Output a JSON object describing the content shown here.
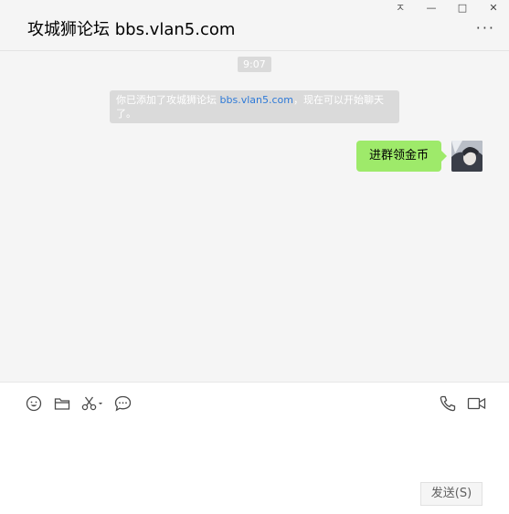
{
  "window": {
    "pin_glyph": "ㅈ",
    "minimize_glyph": "—",
    "maximize_glyph": "□",
    "close_glyph": "✕"
  },
  "header": {
    "title": "攻城狮论坛 bbs.vlan5.com",
    "more_glyph": "···"
  },
  "chat": {
    "timestamp": "9:07",
    "system_message": {
      "prefix": "你已添加了攻城狮论坛 ",
      "link": "bbs.vlan5.com",
      "suffix": "，现在可以开始聊天了。"
    },
    "messages": [
      {
        "text": "进群领金币",
        "sender": "me"
      }
    ]
  },
  "toolbar": {
    "icons": [
      "emoji-icon",
      "folder-icon",
      "scissors-icon",
      "chat-bubble-icon",
      "phone-icon",
      "video-icon"
    ]
  },
  "composer": {
    "send_label": "发送(S)"
  },
  "colors": {
    "bubble": "#9eea6a",
    "link": "#2e7ad8",
    "background": "#f5f5f5"
  }
}
